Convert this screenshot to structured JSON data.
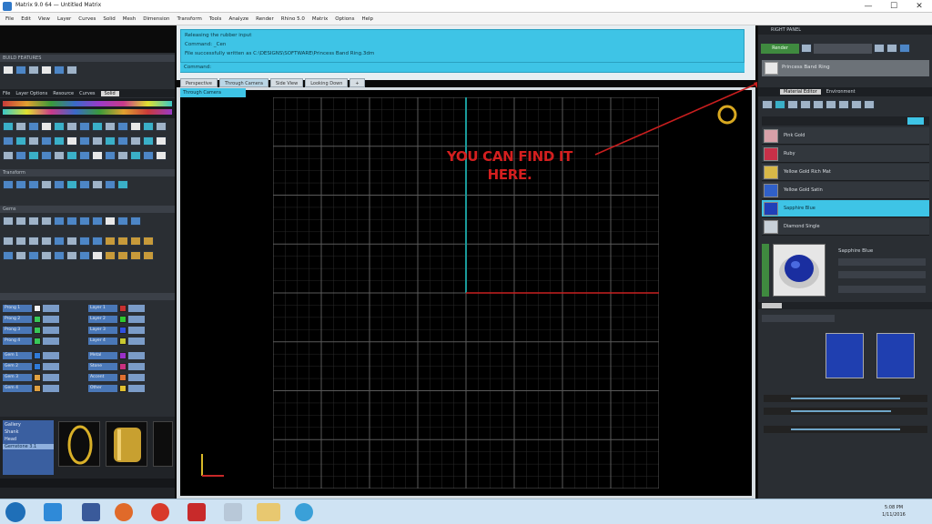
{
  "window": {
    "title": "Matrix 9.0 64 — Untitled Matrix",
    "controls": [
      "—",
      "☐",
      "✕"
    ]
  },
  "menu": {
    "items": [
      "File",
      "Edit",
      "View",
      "Layer",
      "Curves",
      "Solid",
      "Mesh",
      "Dimension",
      "Transform",
      "Tools",
      "Analyze",
      "Render",
      "Rhino 5.0",
      "Matrix",
      "Options",
      "Help"
    ]
  },
  "command": {
    "lines": [
      "Releasing the rubber input",
      "Command: _Cen",
      "File successfully written as C:\\DESIGNS\\SOFTWARE\\Princess Band Ring.3dm"
    ],
    "prompt": "Command:"
  },
  "viewport": {
    "tabs": [
      "Perspective",
      "Through Camera",
      "Side View",
      "Looking Down",
      "+"
    ],
    "active_label": "Through Camera"
  },
  "annotation": {
    "text": "YOU CAN FIND IT HERE.",
    "color": "#d41f1f"
  },
  "left_panel": {
    "section_builder": "BUILD FEATURES",
    "tabs": [
      "File",
      "Layer Options",
      "Resource",
      "Curves",
      "Solid"
    ],
    "section_transform": "Transform",
    "section_gems": "Gems",
    "color_labels": [
      "Prong 1",
      "Prong 2",
      "Prong 3",
      "Prong 4",
      "Gem 1",
      "Gem 2",
      "Gem 3",
      "Gem 4"
    ],
    "color_labels_right": [
      "Layer 1",
      "Layer 2",
      "Layer 3",
      "Layer 4",
      "Metal",
      "Stone",
      "Accent",
      "Other"
    ],
    "object_list": [
      "Gallery",
      "Shank",
      "Head",
      "Gemstone 3.1"
    ]
  },
  "right_panel": {
    "header": "RIGHT PANEL",
    "render_button": "Render",
    "scene_label": "Princess Band Ring",
    "tabs": [
      "Material Editor",
      "Environment"
    ],
    "materials": [
      "Pink Gold",
      "Ruby",
      "Yellow Gold Rich Mat",
      "Yellow Gold Satin",
      "Sapphire Blue",
      "Diamond Single"
    ],
    "material_selected_index": 4,
    "material_title": "Sapphire Blue",
    "accent_color": "#3ec4e6"
  },
  "taskbar": {
    "time": "5:08 PM",
    "date": "1/11/2016"
  }
}
